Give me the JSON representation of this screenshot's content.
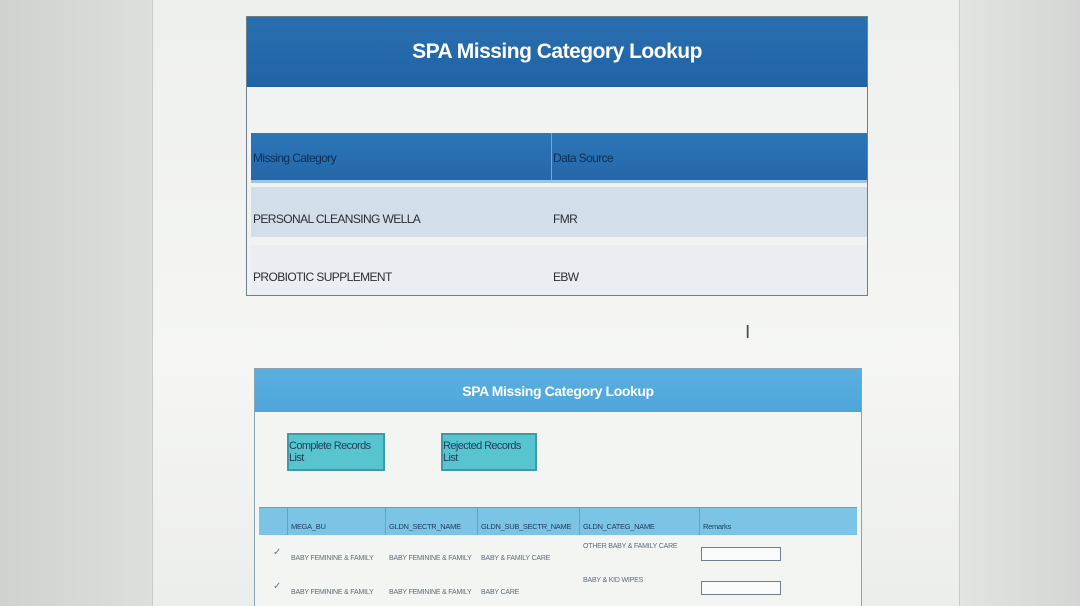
{
  "panel1": {
    "title": "SPA Missing Category Lookup",
    "columns": [
      "Missing Category",
      "Data Source"
    ],
    "rows": [
      {
        "category": "PERSONAL CLEANSING WELLA",
        "source": "FMR"
      },
      {
        "category": "PROBIOTIC SUPPLEMENT",
        "source": "EBW"
      }
    ]
  },
  "panel2": {
    "title": "SPA Missing Category Lookup",
    "buttons": {
      "complete": "Complete Records List",
      "rejected": "Rejected Records List"
    },
    "columns": [
      "MEGA_BU",
      "GLDN_SECTR_NAME",
      "GLDN_SUB_SECTR_NAME",
      "GLDN_CATEG_NAME",
      "Remarks"
    ],
    "rows": [
      {
        "checked": "✓",
        "mega_bu": "BABY FEMININE & FAMILY",
        "sectr": "BABY FEMININE & FAMILY",
        "sub_sectr": "BABY & FAMILY CARE",
        "categ": "OTHER BABY & FAMILY CARE"
      },
      {
        "checked": "✓",
        "mega_bu": "BABY FEMININE & FAMILY",
        "sectr": "BABY FEMININE & FAMILY",
        "sub_sectr": "BABY CARE",
        "categ": "BABY & KID WIPES"
      }
    ]
  },
  "colors": {
    "panel1_header": "#1f63a6",
    "panel2_header": "#4ea6d9",
    "button": "#57c4cf"
  }
}
